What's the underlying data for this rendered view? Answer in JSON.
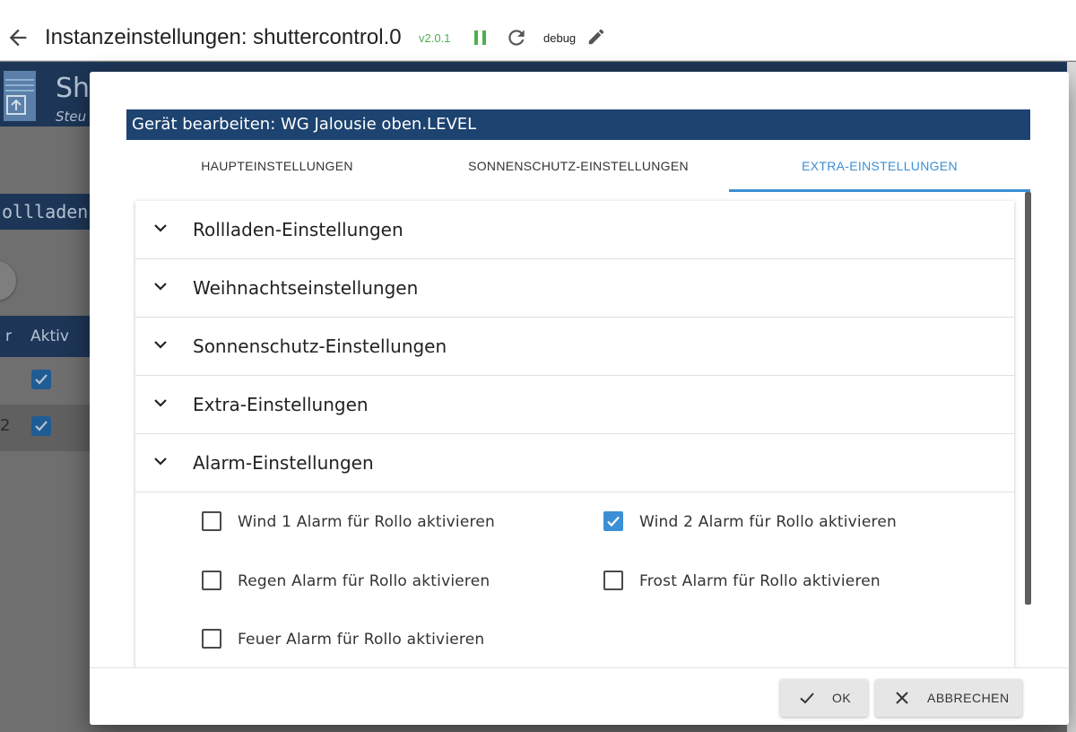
{
  "topbar": {
    "title": "Instanzeinstellungen: shuttercontrol.0",
    "version": "v2.0.1",
    "loglevel": "debug",
    "icons": [
      "arrow-left-icon",
      "pause-icon",
      "reload-icon",
      "pencil-icon"
    ]
  },
  "background_app": {
    "title": "Sh",
    "subtitle": "Steu",
    "section_label": "ollladen-E",
    "table_header_partial": "r",
    "table_header_aktiv": "Aktiv",
    "row2_number": "2"
  },
  "dialog": {
    "title": "Gerät bearbeiten: WG Jalousie oben.LEVEL",
    "tabs": [
      {
        "label": "HAUPTEINSTELLUNGEN",
        "active": false
      },
      {
        "label": "SONNENSCHUTZ-EINSTELLUNGEN",
        "active": false
      },
      {
        "label": "EXTRA-EINSTELLUNGEN",
        "active": true
      }
    ],
    "accordion": [
      {
        "label": "Rollladen-Einstellungen",
        "expanded": false
      },
      {
        "label": "Weihnachtseinstellungen",
        "expanded": false
      },
      {
        "label": "Sonnenschutz-Einstellungen",
        "expanded": false
      },
      {
        "label": "Extra-Einstellungen",
        "expanded": false
      },
      {
        "label": "Alarm-Einstellungen",
        "expanded": true
      }
    ],
    "alarm_options": [
      {
        "label": "Wind 1 Alarm für Rollo aktivieren",
        "checked": false
      },
      {
        "label": "Wind 2 Alarm für Rollo aktivieren",
        "checked": true
      },
      {
        "label": "Regen Alarm für Rollo aktivieren",
        "checked": false
      },
      {
        "label": "Frost Alarm für Rollo aktivieren",
        "checked": false
      },
      {
        "label": "Feuer Alarm für Rollo aktivieren",
        "checked": false
      }
    ],
    "buttons": {
      "ok": "OK",
      "cancel": "ABBRECHEN"
    }
  },
  "colors": {
    "accent": "#3b8fd4",
    "title_bar": "#1d4370",
    "version_green": "#4caf50",
    "checkbox_checked": "#3b8fd4"
  }
}
